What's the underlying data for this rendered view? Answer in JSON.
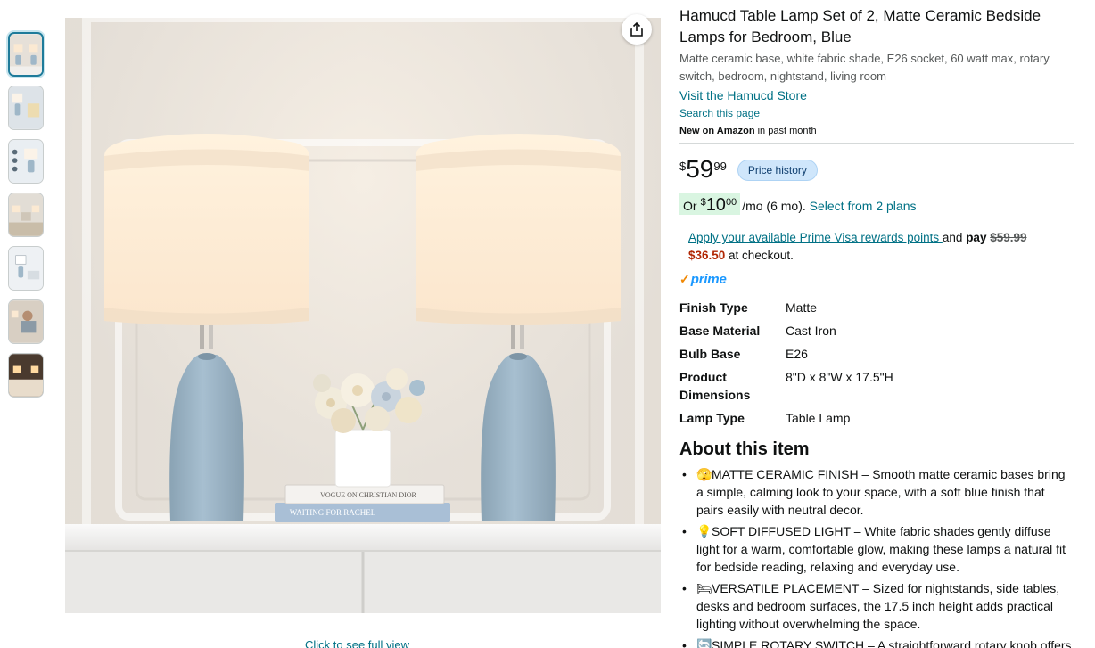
{
  "thumbnails": [
    {
      "label": "Thumbnail 1",
      "selected": true
    },
    {
      "label": "Thumbnail 2",
      "selected": false
    },
    {
      "label": "Thumbnail 3",
      "selected": false
    },
    {
      "label": "Thumbnail 4",
      "selected": false
    },
    {
      "label": "Thumbnail 5",
      "selected": false
    },
    {
      "label": "Thumbnail 6",
      "selected": false
    },
    {
      "label": "Thumbnail 7",
      "selected": false
    }
  ],
  "image": {
    "book_top": "VOGUE ON CHRISTIAN DIOR",
    "book_bottom": "WAITING FOR RACHEL",
    "full_view_link": "Click to see full view",
    "share_icon": "share-icon"
  },
  "product": {
    "title": "Hamucd Table Lamp Set of 2, Matte Ceramic Bedside Lamps for Bedroom, Blue",
    "subtitle": "Matte ceramic base, white fabric shade, E26 socket, 60 watt max, rotary switch, bedroom, nightstand, living room",
    "store_link": "Visit the Hamucd Store",
    "search_link": "Search this page",
    "new_on_amazon_bold": "New on Amazon",
    "new_on_amazon_rest": " in past month"
  },
  "price": {
    "symbol": "$",
    "whole": "59",
    "fraction": "99",
    "history_button": "Price history"
  },
  "monthly": {
    "or": "Or",
    "symbol": "$",
    "whole": "10",
    "fraction": "00",
    "term": "/mo (6 mo).",
    "plans_link": "Select from 2 plans"
  },
  "prime_visa": {
    "link": "Apply your available Prime Visa rewards points ",
    "and_pay": "and",
    "pay": "pay",
    "original": "$59.99",
    "discounted": "$36.50",
    "at_checkout": " at checkout."
  },
  "prime": {
    "check": "✓",
    "word": "prime"
  },
  "specs": [
    {
      "key": "Finish Type",
      "value": "Matte"
    },
    {
      "key": "Base Material",
      "value": "Cast Iron"
    },
    {
      "key": "Bulb Base",
      "value": "E26"
    },
    {
      "key": "Product Dimensions",
      "value": "8\"D x 8\"W x 17.5\"H"
    },
    {
      "key": "Lamp Type",
      "value": "Table Lamp"
    }
  ],
  "about": {
    "title": "About this item",
    "bullets": [
      {
        "emoji": "🫣",
        "text": "MATTE CERAMIC FINISH – Smooth matte ceramic bases bring a simple, calming look to your space, with a soft blue finish that pairs easily with neutral decor."
      },
      {
        "emoji": "💡",
        "text": "SOFT DIFFUSED LIGHT – White fabric shades gently diffuse light for a warm, comfortable glow, making these lamps a natural fit for bedside reading, relaxing and everyday use."
      },
      {
        "emoji": "🛏",
        "text": "VERSATILE PLACEMENT – Sized for nightstands, side tables, desks and bedroom surfaces, the 17.5 inch height adds practical lighting without overwhelming the space."
      },
      {
        "emoji": "🔄",
        "text": "SIMPLE ROTARY SWITCH – A straightforward rotary knob offers easy on and off control."
      }
    ]
  },
  "colors": {
    "link": "#007185",
    "price_red": "#b12704",
    "prime_blue": "#1a98ff",
    "lamp_blue": "#9fb7c8",
    "shade": "#fbe9d2"
  }
}
